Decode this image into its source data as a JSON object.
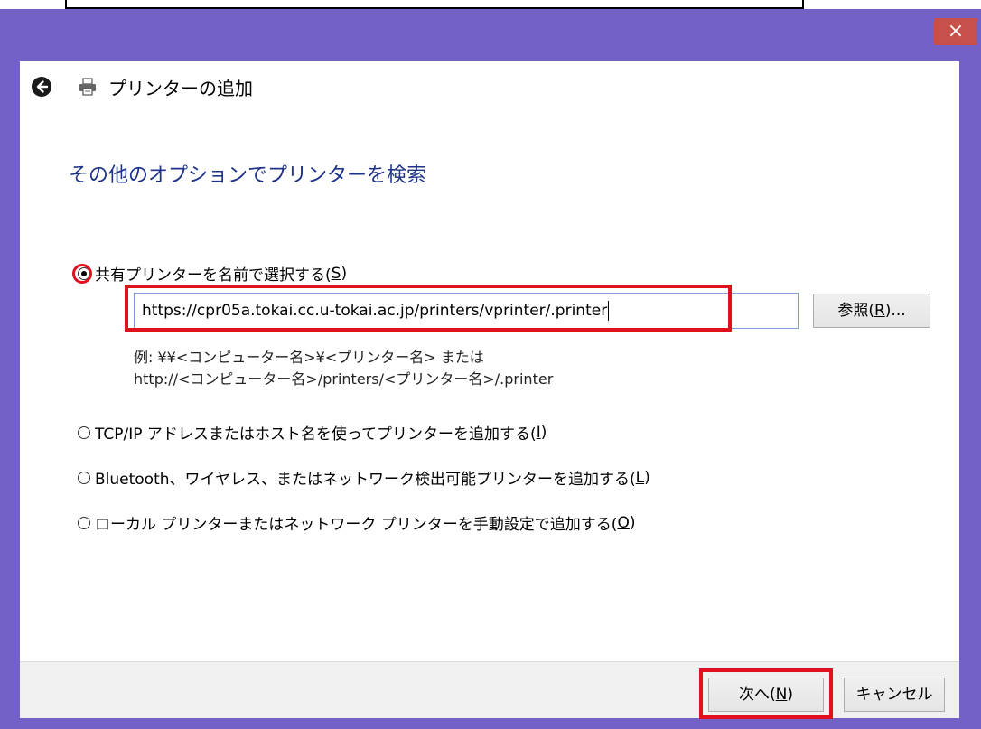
{
  "window": {
    "title": "プリンターの追加",
    "close_label": "×"
  },
  "page": {
    "heading": "その他のオプションでプリンターを検索"
  },
  "options": [
    {
      "text": "共有プリンターを名前で選択する(",
      "key": "S",
      "end": ")",
      "checked": true
    },
    {
      "text": "TCP/IP アドレスまたはホスト名を使ってプリンターを追加する(",
      "key": "I",
      "end": ")",
      "checked": false
    },
    {
      "text": "Bluetooth、ワイヤレス、またはネットワーク検出可能プリンターを追加する(",
      "key": "L",
      "end": ")",
      "checked": false
    },
    {
      "text": "ローカル プリンターまたはネットワーク プリンターを手動設定で追加する(",
      "key": "O",
      "end": ")",
      "checked": false
    }
  ],
  "printer_path": {
    "value": "https://cpr05a.tokai.cc.u-tokai.ac.jp/printers/vprinter/.printer"
  },
  "browse_button": {
    "pre": "参照(",
    "key": "R",
    "post": ")..."
  },
  "example": {
    "line1": "例: ¥¥<コンピューター名>¥<プリンター名> または",
    "line2": "http://<コンピューター名>/printers/<プリンター名>/.printer"
  },
  "footer": {
    "next": {
      "pre": "次へ(",
      "key": "N",
      "post": ")"
    },
    "cancel": "キャンセル"
  },
  "colors": {
    "frame": "#7461c8",
    "heading": "#1e3287",
    "highlight": "#e1101f",
    "close": "#c7504a"
  },
  "icons": [
    "back-arrow-icon",
    "printer-icon",
    "close-icon"
  ]
}
